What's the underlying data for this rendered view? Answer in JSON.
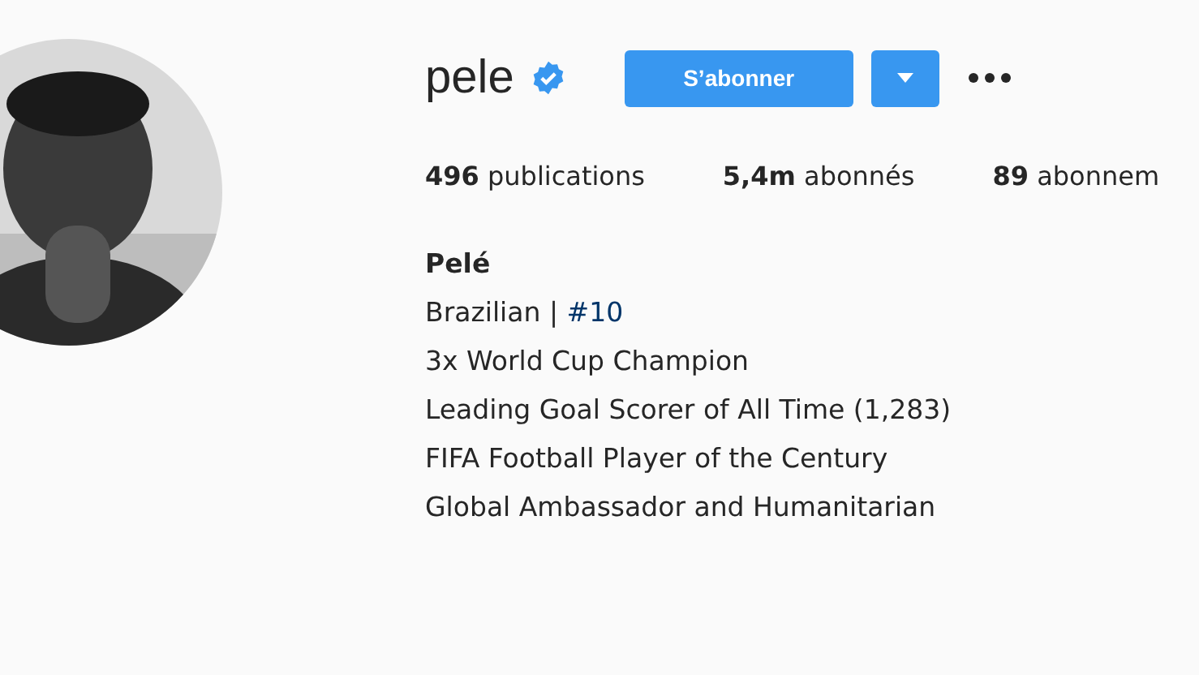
{
  "profile": {
    "username": "pele",
    "verified": true,
    "follow_button": "S’abonner",
    "stats": [
      {
        "count": "496",
        "label": "publications"
      },
      {
        "count": "5,4m",
        "label": "abonnés"
      },
      {
        "count": "89",
        "label": "abonnem"
      }
    ],
    "bio": {
      "name": "Pelé",
      "lines": [
        {
          "text": "Brazilian |",
          "hashtag": "#10"
        },
        {
          "text": "3x World Cup Champion"
        },
        {
          "text": "Leading Goal Scorer of All Time (1,283)"
        },
        {
          "text": "FIFA Football Player of the Century"
        },
        {
          "text": "Global Ambassador and Humanitarian"
        }
      ]
    }
  }
}
